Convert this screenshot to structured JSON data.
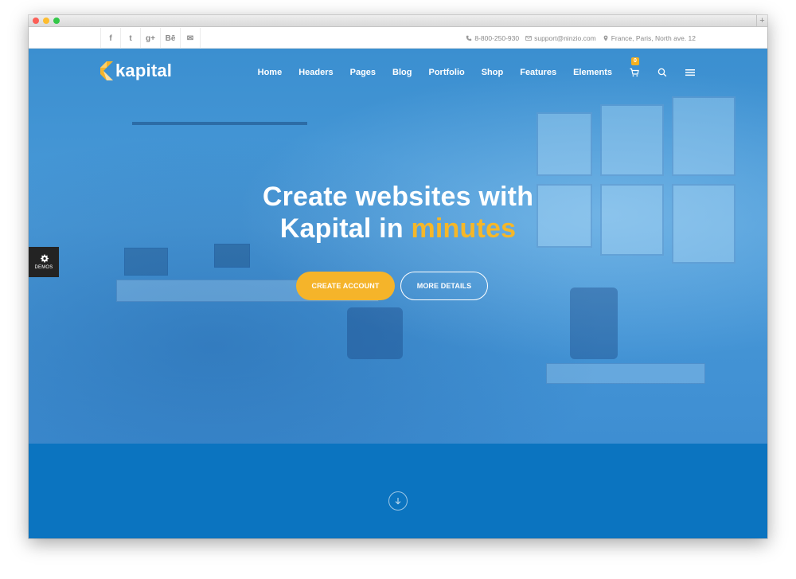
{
  "browser": {
    "new_tab_label": "+"
  },
  "topbar": {
    "socials": [
      {
        "icon": "facebook-icon",
        "glyph": "f"
      },
      {
        "icon": "twitter-icon",
        "glyph": "t"
      },
      {
        "icon": "google-plus-icon",
        "glyph": "g+"
      },
      {
        "icon": "behance-icon",
        "glyph": "Bē"
      },
      {
        "icon": "mail-icon",
        "glyph": "✉"
      }
    ],
    "phone": "8-800-250-930",
    "email": "support@ninzio.com",
    "address": "France, Paris, North ave. 12"
  },
  "header": {
    "logo_text": "kapital",
    "nav": [
      "Home",
      "Headers",
      "Pages",
      "Blog",
      "Portfolio",
      "Shop",
      "Features",
      "Elements"
    ],
    "cart_count": "0",
    "icons": [
      "cart-icon",
      "search-icon",
      "menu-icon"
    ]
  },
  "hero": {
    "headline_line1": "Create websites with",
    "headline_line2_start": "Kapital in ",
    "headline_accent": "minutes",
    "primary_button": "CREATE ACCOUNT",
    "secondary_button": "MORE DETAILS"
  },
  "demos": {
    "label": "DEMOS",
    "icon": "gear-icon"
  },
  "colors": {
    "hero_blue": "#3e8ed2",
    "lower_blue": "#0b74c0",
    "accent_yellow": "#f5b42a",
    "demos_dark": "#232323"
  },
  "lower": {
    "icon": "arrow-down-icon"
  }
}
